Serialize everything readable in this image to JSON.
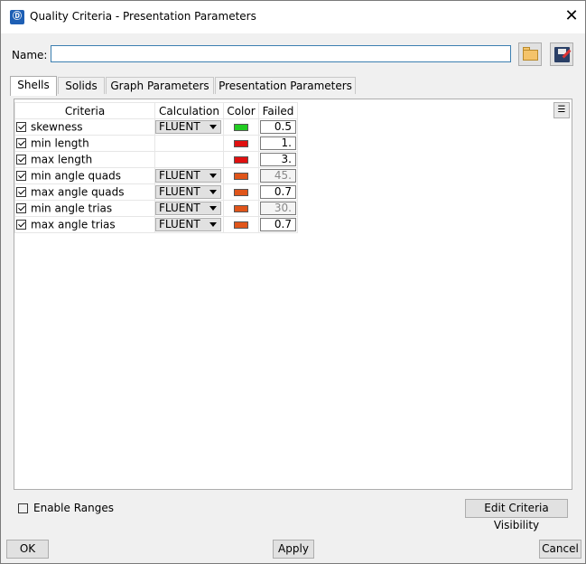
{
  "window": {
    "title": "Quality Criteria - Presentation Parameters",
    "close_glyph": "✕"
  },
  "name_row": {
    "label": "Name:",
    "value": ""
  },
  "tabs": [
    {
      "label": "Shells",
      "active": true
    },
    {
      "label": "Solids",
      "active": false
    },
    {
      "label": "Graph Parameters",
      "active": false
    },
    {
      "label": "Presentation Parameters",
      "active": false
    }
  ],
  "table": {
    "headers": {
      "criteria": "Criteria",
      "calculation": "Calculation",
      "color": "Color",
      "failed": "Failed"
    },
    "rows": [
      {
        "checked": true,
        "criteria": "skewness",
        "calculation": "FLUENT",
        "color": "#22cc22",
        "failed": "0.5",
        "dim": false
      },
      {
        "checked": true,
        "criteria": "min length",
        "calculation": "",
        "color": "#e01010",
        "failed": "1.",
        "dim": false
      },
      {
        "checked": true,
        "criteria": "max length",
        "calculation": "",
        "color": "#e01010",
        "failed": "3.",
        "dim": false
      },
      {
        "checked": true,
        "criteria": "min angle quads",
        "calculation": "FLUENT",
        "color": "#e0551a",
        "failed": "45.",
        "dim": true
      },
      {
        "checked": true,
        "criteria": "max angle quads",
        "calculation": "FLUENT",
        "color": "#e0551a",
        "failed": "0.7",
        "dim": false
      },
      {
        "checked": true,
        "criteria": "min angle trias",
        "calculation": "FLUENT",
        "color": "#e0551a",
        "failed": "30.",
        "dim": true
      },
      {
        "checked": true,
        "criteria": "max angle trias",
        "calculation": "FLUENT",
        "color": "#e0551a",
        "failed": "0.7",
        "dim": false
      }
    ]
  },
  "enable_ranges": {
    "label": "Enable Ranges",
    "checked": false
  },
  "buttons": {
    "edit_visibility": "Edit Criteria Visibility",
    "ok": "OK",
    "apply": "Apply",
    "cancel": "Cancel"
  }
}
